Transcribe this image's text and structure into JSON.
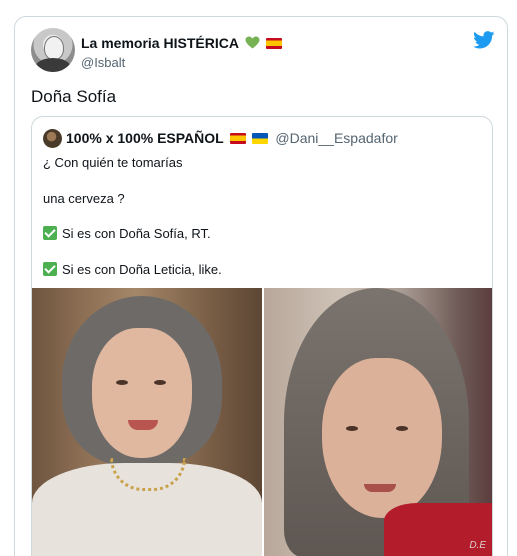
{
  "tweet": {
    "author_name": "La memoria HISTÉRICA",
    "author_handle": "@Isbalt",
    "text": "Doña Sofía"
  },
  "quoted_tweet": {
    "author_name": "100% x 100% ESPAÑOL",
    "author_handle": "@Dani__Espadafor",
    "lines": [
      "¿ Con quién te tomarías",
      "una cerveza ?",
      "Si es con Doña Sofía, RT.",
      "Si es con Doña Leticia, like."
    ],
    "watermark": "D.E"
  },
  "icons": {
    "brand": "twitter-bird-icon",
    "heart": "green-heart-icon",
    "flag_spain": "spain-flag-icon",
    "flag_ukraine": "ukraine-flag-icon",
    "check": "check-mark-icon"
  },
  "colors": {
    "twitter_blue": "#1d9bf0",
    "border": "#cfd9de",
    "secondary_text": "#536471",
    "heart_green": "#77b255",
    "check_green": "#4caf50"
  }
}
